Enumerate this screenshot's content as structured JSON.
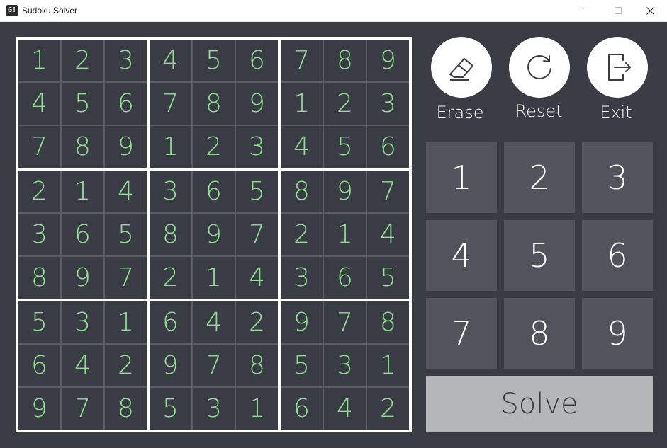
{
  "window": {
    "icon_text": "G!",
    "title": "Sudoku Solver"
  },
  "board": [
    [
      "1",
      "2",
      "3",
      "4",
      "5",
      "6",
      "7",
      "8",
      "9"
    ],
    [
      "4",
      "5",
      "6",
      "7",
      "8",
      "9",
      "1",
      "2",
      "3"
    ],
    [
      "7",
      "8",
      "9",
      "1",
      "2",
      "3",
      "4",
      "5",
      "6"
    ],
    [
      "2",
      "1",
      "4",
      "3",
      "6",
      "5",
      "8",
      "9",
      "7"
    ],
    [
      "3",
      "6",
      "5",
      "8",
      "9",
      "7",
      "2",
      "1",
      "4"
    ],
    [
      "8",
      "9",
      "7",
      "2",
      "1",
      "4",
      "3",
      "6",
      "5"
    ],
    [
      "5",
      "3",
      "1",
      "6",
      "4",
      "2",
      "9",
      "7",
      "8"
    ],
    [
      "6",
      "4",
      "2",
      "9",
      "7",
      "8",
      "5",
      "3",
      "1"
    ],
    [
      "9",
      "7",
      "8",
      "5",
      "3",
      "1",
      "6",
      "4",
      "2"
    ]
  ],
  "actions": {
    "erase_label": "Erase",
    "reset_label": "Reset",
    "exit_label": "Exit"
  },
  "keypad": [
    "1",
    "2",
    "3",
    "4",
    "5",
    "6",
    "7",
    "8",
    "9"
  ],
  "solve_label": "Solve",
  "colors": {
    "background": "#393c44",
    "digit": "#8ee08e",
    "key": "#51545c",
    "solve_button": "#b5b6b8"
  },
  "icons": {
    "erase": "eraser-icon",
    "reset": "reset-icon",
    "exit": "exit-icon"
  }
}
